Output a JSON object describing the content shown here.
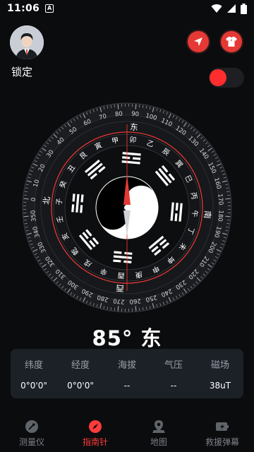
{
  "status_bar": {
    "time": "11:06",
    "badge": "A"
  },
  "profile": {
    "lock_label": "锁定"
  },
  "buttons": {
    "locate_icon": "navigation-arrow-icon",
    "skin_icon": "shirt-icon"
  },
  "toggle": {
    "on": true
  },
  "compass": {
    "heading_degrees": 85,
    "direction": "东",
    "heading_text": "85° 东",
    "cardinals": [
      "北",
      "东",
      "南",
      "西"
    ],
    "mountains": [
      "子",
      "癸",
      "丑",
      "艮",
      "寅",
      "甲",
      "卯",
      "乙",
      "辰",
      "巽",
      "巳",
      "丙",
      "午",
      "丁",
      "未",
      "坤",
      "申",
      "庚",
      "酉",
      "辛",
      "戌",
      "乾",
      "亥",
      "壬"
    ],
    "degree_labels": [
      "0",
      "10",
      "20",
      "30",
      "40",
      "50",
      "60",
      "70",
      "80",
      "90",
      "100",
      "110",
      "120",
      "130",
      "140",
      "150",
      "160",
      "170",
      "180",
      "190",
      "200",
      "210",
      "220",
      "230",
      "240",
      "250",
      "260",
      "270",
      "280",
      "290",
      "300",
      "310",
      "320",
      "330",
      "340",
      "350"
    ],
    "accent_color": "#e53935"
  },
  "info": {
    "items": [
      {
        "label": "纬度",
        "value": "0°0'0\""
      },
      {
        "label": "经度",
        "value": "0°0'0\""
      },
      {
        "label": "海拔",
        "value": "--"
      },
      {
        "label": "气压",
        "value": "--"
      },
      {
        "label": "磁场",
        "value": "38uT"
      }
    ]
  },
  "tabs": [
    {
      "label": "测量仪",
      "icon": "measure-icon",
      "active": false
    },
    {
      "label": "指南针",
      "icon": "compass-icon",
      "active": true
    },
    {
      "label": "地图",
      "icon": "map-pin-icon",
      "active": false
    },
    {
      "label": "救援弹幕",
      "icon": "rescue-icon",
      "active": false
    }
  ],
  "colors": {
    "accent": "#ff2d2d",
    "background": "#0b0c0e",
    "card": "#1c2128"
  }
}
